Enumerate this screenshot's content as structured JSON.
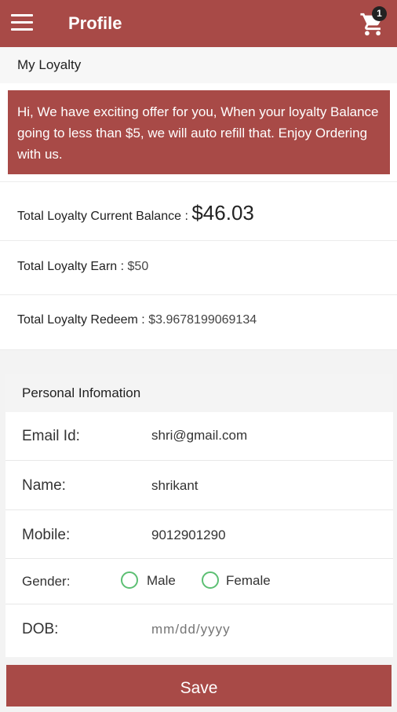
{
  "appbar": {
    "title": "Profile",
    "cart_count": "1",
    "menu_icon": "hamburger-menu-icon",
    "cart_icon": "shopping-cart-icon"
  },
  "loyalty": {
    "section_title": "My Loyalty",
    "offer_text": "Hi, We have exciting offer for you, When your loyalty Balance going to less than $5, we will auto refill that. Enjoy Ordering with us.",
    "balance_label": "Total Loyalty Current Balance : ",
    "balance_value": "$46.03",
    "earn_label": "Total Loyalty Earn : ",
    "earn_value": "$50",
    "redeem_label": "Total Loyalty Redeem : ",
    "redeem_value": "$3.9678199069134"
  },
  "personal": {
    "section_title": "Personal Infomation",
    "email_label": "Email Id:",
    "email_value": "shri@gmail.com",
    "name_label": "Name:",
    "name_value": "shrikant",
    "mobile_label": "Mobile:",
    "mobile_value": "9012901290",
    "gender_label": "Gender:",
    "gender_options": [
      "Male",
      "Female"
    ],
    "dob_label": "DOB:",
    "dob_placeholder": "mm/dd/yyyy"
  },
  "save_label": "Save",
  "colors": {
    "primary": "#a84a47",
    "radio": "#5cbf73"
  }
}
